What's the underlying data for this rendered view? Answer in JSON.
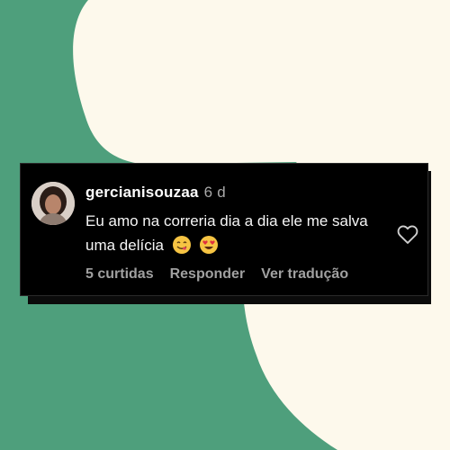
{
  "colors": {
    "background_cream": "#fdf9ec",
    "background_green": "#4e9f7c",
    "card_bg": "#000000",
    "text_primary": "#ffffff",
    "text_secondary": "#a8a8a8"
  },
  "comment": {
    "username": "gercianisouzaa",
    "time": "6 d",
    "text": "Eu amo na correria dia a dia ele me salva uma delícia",
    "emojis": [
      "face-savoring-food-emoji",
      "heart-eyes-emoji"
    ],
    "avatar_icon": "user-avatar",
    "like_icon": "heart-outline-icon"
  },
  "actions": {
    "likes": "5 curtidas",
    "reply": "Responder",
    "translate": "Ver tradução"
  }
}
